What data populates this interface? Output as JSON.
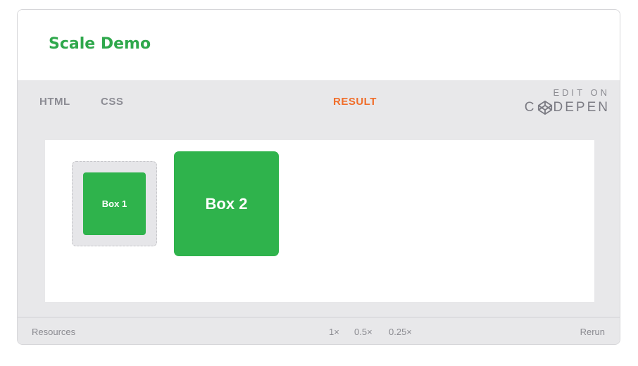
{
  "header": {
    "title": "Scale Demo"
  },
  "tabs": [
    {
      "label": "HTML",
      "active": false
    },
    {
      "label": "CSS",
      "active": false
    },
    {
      "label": "RESULT",
      "active": true
    }
  ],
  "codepen": {
    "edit_on": "EDIT ON",
    "brand_left": "C",
    "brand_right": "DEPEN",
    "icon": "codepen-logo-icon"
  },
  "result": {
    "box1_label": "Box 1",
    "box2_label": "Box 2"
  },
  "footer": {
    "resources": "Resources",
    "zoom_levels": [
      "1×",
      "0.5×",
      "0.25×"
    ],
    "rerun": "Rerun"
  },
  "colors": {
    "title": "#2fa84c",
    "active_tab": "#f06e2b",
    "box_fill": "#2fb34c",
    "embed_bg": "#e8e8ea"
  }
}
